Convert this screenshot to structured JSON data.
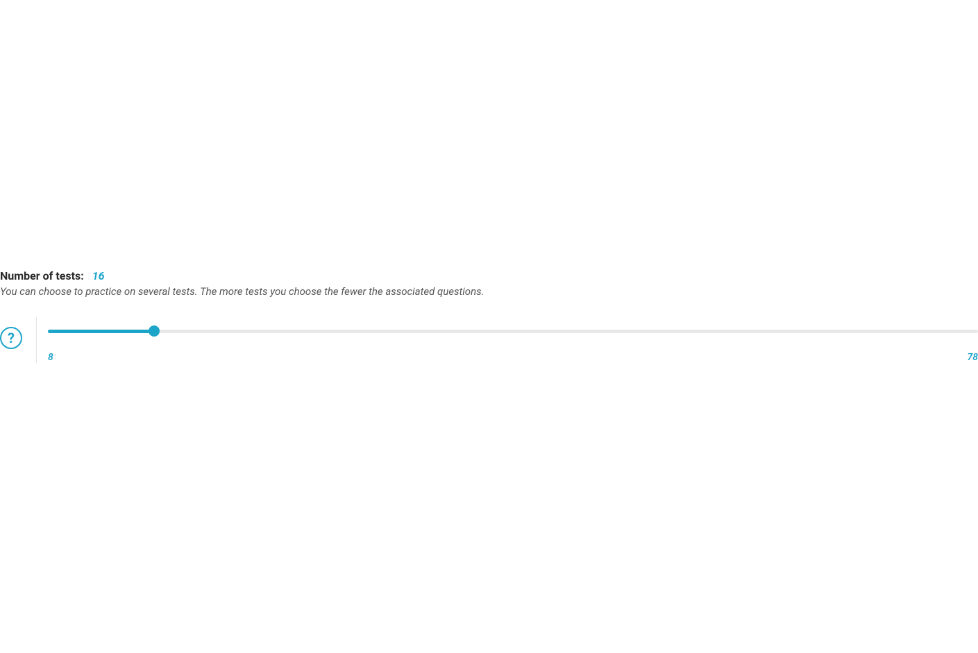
{
  "slider": {
    "title": "Number of tests:",
    "value": "16",
    "description": "You can choose to practice on several tests. The more tests you choose the fewer the associated questions.",
    "min": "8",
    "max": "78",
    "min_num": 8,
    "max_num": 78,
    "current_num": 16,
    "help_symbol": "?"
  }
}
